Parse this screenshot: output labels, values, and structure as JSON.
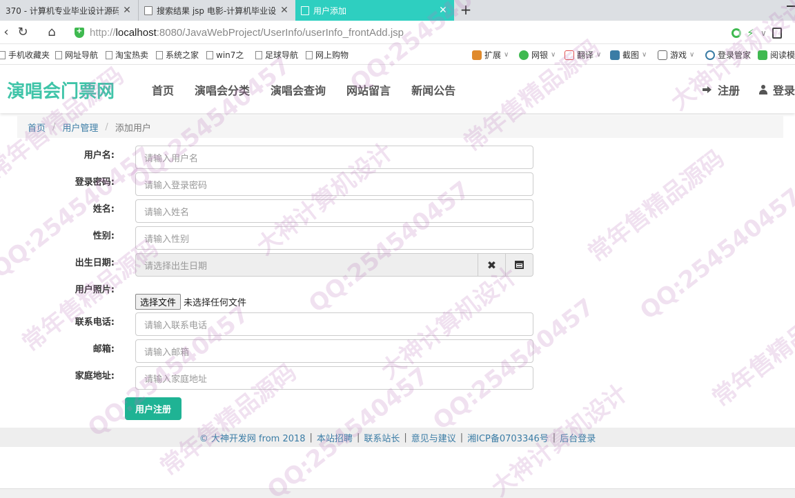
{
  "browser": {
    "tabs": [
      {
        "label": "370 - 计算机专业毕业设计源码",
        "active": false
      },
      {
        "label": "搜索结果 jsp 电影-计算机毕业设",
        "active": false
      },
      {
        "label": "用户添加",
        "active": true
      }
    ],
    "new_tab": "+",
    "url": {
      "protocol": "http://",
      "host": "localhost",
      "rest": ":8080/JavaWebProject/UserInfo/userInfo_frontAdd.jsp"
    },
    "bookmarks": [
      "手机收藏夹",
      "网址导航",
      "淘宝热卖",
      "系统之家",
      "win7之",
      "足球导航",
      "网上购物"
    ],
    "tools": [
      {
        "label": "扩展",
        "icon": "extension-icon",
        "color": "#e08a2c"
      },
      {
        "label": "网银",
        "icon": "bank-icon",
        "color": "#3fb950"
      },
      {
        "label": "翻译",
        "icon": "translate-icon",
        "color": "#e05050"
      },
      {
        "label": "截图",
        "icon": "scissors-icon",
        "color": "#3a7ca5"
      },
      {
        "label": "游戏",
        "icon": "gamepad-icon",
        "color": "#666666"
      },
      {
        "label": "登录管家",
        "icon": "key-icon",
        "color": "#3a7ca5"
      },
      {
        "label": "阅读模",
        "icon": "book-icon",
        "color": "#3fb950"
      }
    ]
  },
  "site": {
    "brand": "演唱会门票网",
    "brand_color": "#3fc4a8",
    "nav": [
      "首页",
      "演唱会分类",
      "演唱会查询",
      "网站留言",
      "新闻公告"
    ],
    "user_nav": {
      "register": "注册",
      "login": "登录"
    }
  },
  "breadcrumb": {
    "home": "首页",
    "section": "用户管理",
    "current": "添加用户"
  },
  "form": {
    "username": {
      "label": "用户名:",
      "placeholder": "请输入用户名"
    },
    "password": {
      "label": "登录密码:",
      "placeholder": "请输入登录密码"
    },
    "name": {
      "label": "姓名:",
      "placeholder": "请输入姓名"
    },
    "gender": {
      "label": "性别:",
      "placeholder": "请输入性别"
    },
    "birthday": {
      "label": "出生日期:",
      "placeholder": "请选择出生日期",
      "clear_icon": "✖"
    },
    "photo": {
      "label": "用户照片:",
      "button": "选择文件",
      "status": "未选择任何文件"
    },
    "phone": {
      "label": "联系电话:",
      "placeholder": "请输入联系电话"
    },
    "email": {
      "label": "邮箱:",
      "placeholder": "请输入邮箱"
    },
    "address": {
      "label": "家庭地址:",
      "placeholder": "请输入家庭地址"
    },
    "submit": "用户注册",
    "submit_color": "#1fb394"
  },
  "footer": {
    "copyright": "© 大神开发网 from 2018",
    "links": [
      "本站招聘",
      "联系站长",
      "意见与建议",
      "湘ICP备0703346号",
      "后台登录"
    ]
  },
  "watermark": [
    "大神计算机设计",
    "常年售精品源码",
    "QQ:254540457"
  ]
}
